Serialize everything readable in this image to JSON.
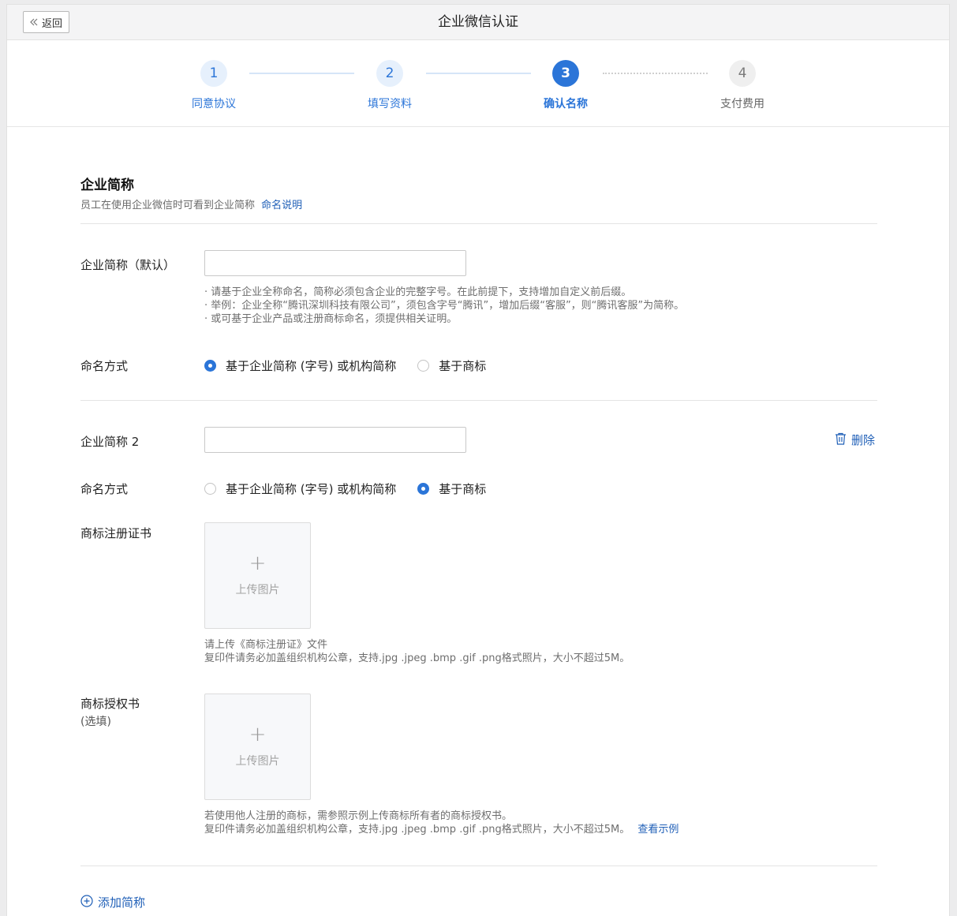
{
  "header": {
    "back_label": "返回",
    "title": "企业微信认证"
  },
  "steps": [
    {
      "number": "1",
      "label": "同意协议",
      "state": "done"
    },
    {
      "number": "2",
      "label": "填写资料",
      "state": "done"
    },
    {
      "number": "3",
      "label": "确认名称",
      "state": "active"
    },
    {
      "number": "4",
      "label": "支付费用",
      "state": "todo"
    }
  ],
  "section": {
    "title": "企业简称",
    "desc": "员工在使用企业微信时可看到企业简称",
    "naming_link": "命名说明"
  },
  "name1": {
    "label": "企业简称（默认）",
    "value": "",
    "hints": [
      "· 请基于企业全称命名，简称必须包含企业的完整字号。在此前提下，支持增加自定义前后缀。",
      "· 举例：企业全称“腾讯深圳科技有限公司”，须包含字号“腾讯”，增加后缀“客服”，则“腾讯客服”为简称。",
      "· 或可基于企业产品或注册商标命名，须提供相关证明。"
    ],
    "mode_label": "命名方式",
    "options": [
      "基于企业简称 (字号) 或机构简称",
      "基于商标"
    ],
    "selected_index": 0
  },
  "name2": {
    "label": "企业简称 2",
    "value": "",
    "delete_label": "删除",
    "mode_label": "命名方式",
    "options": [
      "基于企业简称 (字号) 或机构简称",
      "基于商标"
    ],
    "selected_index": 1,
    "cert": {
      "label": "商标注册证书",
      "upload_plus": "+",
      "upload_text": "上传图片",
      "hint_line1": "请上传《商标注册证》文件",
      "hint_line2": "复印件请务必加盖组织机构公章，支持.jpg .jpeg .bmp .gif .png格式照片，大小不超过5M。"
    },
    "auth": {
      "label": "商标授权书",
      "sublabel": "(选填)",
      "upload_plus": "+",
      "upload_text": "上传图片",
      "hint_line1": "若使用他人注册的商标，需参照示例上传商标所有者的商标授权书。",
      "hint_line2": "复印件请务必加盖组织机构公章，支持.jpg .jpeg .bmp .gif .png格式照片，大小不超过5M。",
      "example_link": "查看示例"
    }
  },
  "add_label": "添加简称",
  "colors": {
    "accent": "#2b75d8",
    "link": "#1f5fb7",
    "step_done_bg": "#e6f0fc"
  }
}
